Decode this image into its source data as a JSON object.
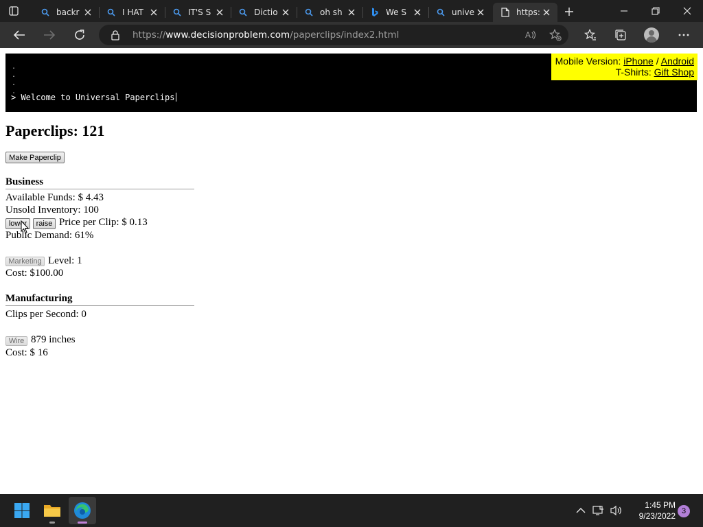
{
  "browser": {
    "tabs": [
      {
        "label": "backr",
        "icon": "search-icon"
      },
      {
        "label": "I HAT",
        "icon": "search-icon"
      },
      {
        "label": "IT'S S",
        "icon": "search-icon"
      },
      {
        "label": "Dictio",
        "icon": "search-icon"
      },
      {
        "label": "oh sh",
        "icon": "search-icon"
      },
      {
        "label": "We S",
        "icon": "bing-icon"
      },
      {
        "label": "unive",
        "icon": "search-icon"
      },
      {
        "label": "https:",
        "icon": "page-icon",
        "active": true
      }
    ],
    "address": {
      "prefix": "https://",
      "host": "www.decisionproblem.com",
      "path": "/paperclips/index2.html"
    }
  },
  "console": {
    "welcome": "> Welcome to Universal Paperclips"
  },
  "promo": {
    "mobile_label": "Mobile Version:",
    "iphone": "iPhone",
    "sep": "/",
    "android": "Android",
    "tshirts_label": "T-Shirts:",
    "gift_shop": "Gift Shop"
  },
  "game": {
    "paperclips_label": "Paperclips:",
    "paperclips": "121",
    "make_button": "Make Paperclip",
    "business": {
      "heading": "Business",
      "funds_label": "Available Funds: $",
      "funds": "4.43",
      "inventory_label": "Unsold Inventory:",
      "inventory": "100",
      "lower_button": "lower",
      "raise_button": "raise",
      "price_label": "Price per Clip: $",
      "price": "0.13",
      "demand_label": "Public Demand:",
      "demand": "61%",
      "marketing_button": "Marketing",
      "level_label": "Level:",
      "level": "1",
      "cost_label": "Cost: $",
      "cost": "100.00"
    },
    "manufacturing": {
      "heading": "Manufacturing",
      "cps_label": "Clips per Second:",
      "cps": "0",
      "wire_button": "Wire",
      "wire_amount": "879",
      "wire_unit": "inches",
      "cost_label": "Cost: $",
      "cost": "16"
    }
  },
  "taskbar": {
    "time": "1:45 PM",
    "date": "9/23/2022",
    "notifications": "3"
  }
}
